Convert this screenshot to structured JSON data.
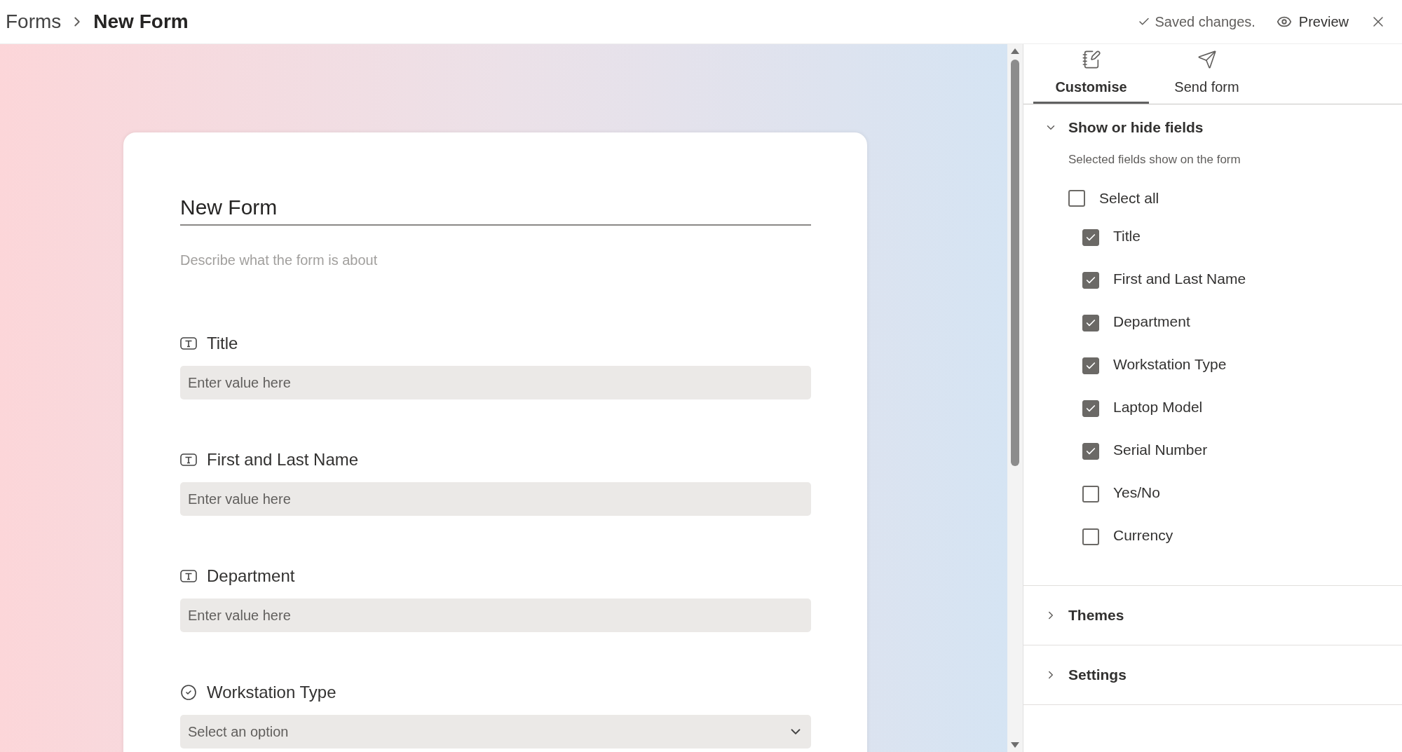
{
  "breadcrumb": [
    {
      "label": "Forms"
    },
    {
      "label": "New Form"
    }
  ],
  "header": {
    "status": "Saved changes.",
    "preview": "Preview"
  },
  "form": {
    "title": "New Form",
    "description_placeholder": "Describe what the form is about",
    "fields": [
      {
        "kind": "text",
        "label": "Title",
        "placeholder": "Enter value here"
      },
      {
        "kind": "text",
        "label": "First and Last Name",
        "placeholder": "Enter value here"
      },
      {
        "kind": "text",
        "label": "Department",
        "placeholder": "Enter value here"
      },
      {
        "kind": "choice",
        "label": "Workstation Type",
        "placeholder": "Select an option"
      }
    ]
  },
  "panel": {
    "tabs": [
      {
        "kind": "customise",
        "label": "Customise",
        "selected": true
      },
      {
        "kind": "send",
        "label": "Send form",
        "selected": false
      }
    ],
    "sections": [
      {
        "title": "Show or hide fields",
        "expanded": true,
        "subtitle": "Selected fields show on the form",
        "select_all": {
          "label": "Select all",
          "checked": false
        },
        "items": [
          {
            "label": "Title",
            "checked": true
          },
          {
            "label": "First and Last Name",
            "checked": true
          },
          {
            "label": "Department",
            "checked": true
          },
          {
            "label": "Workstation Type",
            "checked": true
          },
          {
            "label": "Laptop Model",
            "checked": true
          },
          {
            "label": "Serial Number",
            "checked": true
          },
          {
            "label": "Yes/No",
            "checked": false
          },
          {
            "label": "Currency",
            "checked": false
          }
        ]
      },
      {
        "title": "Themes",
        "expanded": false
      },
      {
        "title": "Settings",
        "expanded": false
      }
    ]
  }
}
